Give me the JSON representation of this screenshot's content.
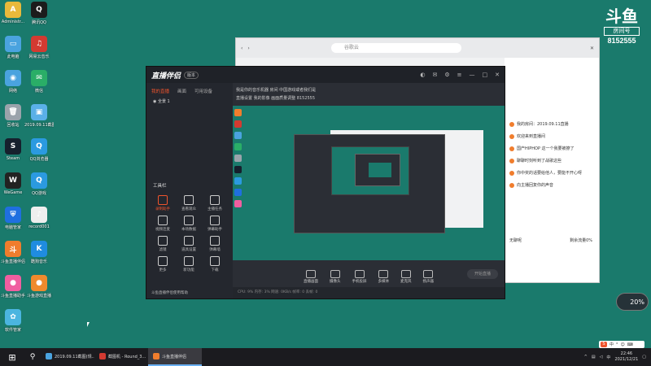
{
  "desktop_icons": [
    {
      "label": "Administr...",
      "color": "#e8b93b",
      "glyph": "A"
    },
    {
      "label": "腾讯QQ",
      "color": "#1c1c1c",
      "glyph": "Q"
    },
    {
      "label": "此电脑",
      "color": "#4aa3df",
      "glyph": "▭"
    },
    {
      "label": "网易云音乐",
      "color": "#d33a31",
      "glyph": "♫"
    },
    {
      "label": "网络",
      "color": "#4aa3df",
      "glyph": "◉"
    },
    {
      "label": "微信",
      "color": "#2aae67",
      "glyph": "✉"
    },
    {
      "label": "回收站",
      "color": "#9aa3ab",
      "glyph": "🗑"
    },
    {
      "label": "2019.09.11截图",
      "color": "#5ab0e8",
      "glyph": "▣"
    },
    {
      "label": "Steam",
      "color": "#16202d",
      "glyph": "S"
    },
    {
      "label": "QQ浏览器",
      "color": "#2b9ae0",
      "glyph": "Q"
    },
    {
      "label": "WeGame",
      "color": "#222",
      "glyph": "W"
    },
    {
      "label": "QQ游戏",
      "color": "#2b9ae0",
      "glyph": "Q"
    },
    {
      "label": "电脑管家",
      "color": "#1f6fe0",
      "glyph": "⛨"
    },
    {
      "label": "record001",
      "color": "#eee",
      "glyph": "♪"
    },
    {
      "label": "斗鱼直播伴侣",
      "color": "#f07d2d",
      "glyph": "斗"
    },
    {
      "label": "酷狗音乐",
      "color": "#1f8ce0",
      "glyph": "K"
    },
    {
      "label": "斗鱼直播助手",
      "color": "#f05ea0",
      "glyph": "●"
    },
    {
      "label": "斗鱼游戏直播",
      "color": "#f08a2d",
      "glyph": "●"
    },
    {
      "label": "软件管家",
      "color": "#4bb5e0",
      "glyph": "✿"
    }
  ],
  "douyu": {
    "logo": "斗鱼",
    "room_label": "房间号",
    "room_number": "8152555"
  },
  "browser": {
    "address": "谷歌云",
    "chat": [
      "我的房间：2019.09.11直播",
      "欢迎来到直播间",
      "国产HIPHOP 这一个我要被撩了",
      "聊聊时刻听到了战歌这些",
      "你中奖的话要给他人，要能不开心呀",
      "向主播回复你的声音"
    ],
    "bottom_left": "无聊呢",
    "bottom_right": "剩余流量0%"
  },
  "app": {
    "title": "直播伴侣",
    "version": "版本",
    "tabs": [
      "我的直播",
      "画面",
      "可用设备"
    ],
    "scene": "全景 1",
    "tools_title": "工具栏",
    "tools": [
      {
        "label": "录制助手",
        "red": true
      },
      {
        "label": "查看观众",
        "red": false
      },
      {
        "label": "主播任务",
        "red": false
      },
      {
        "label": "视频连麦",
        "red": false
      },
      {
        "label": "本场数据",
        "red": false
      },
      {
        "label": "弹幕助手",
        "red": false
      },
      {
        "label": "滤镜",
        "red": false
      },
      {
        "label": "道具设置",
        "red": false
      },
      {
        "label": "弹幕墙",
        "red": false
      },
      {
        "label": "更多",
        "red": false
      },
      {
        "label": "新功能",
        "red": false
      },
      {
        "label": "下载",
        "red": false
      }
    ],
    "footer": "斗鱼直播伴侣使用帮助",
    "room_line1": "我是你的音乐机器  房间  中国游戏或者我们是",
    "room_line2": "直播设置  我的影像  画面质量调整  8152555",
    "controls": [
      "直播画面",
      "摄像头",
      "手机投屏",
      "多媒体",
      "麦克风",
      "扬声器"
    ],
    "start_btn": "开始直播",
    "status": "CPU: 9%  内存: 3%  网速: 0KB/s  帧率: 0  丢帧: 0"
  },
  "taskbar": {
    "items": [
      {
        "label": "2019.09.11截图(规...",
        "color": "#4aa3df",
        "active": false
      },
      {
        "label": "截图机 - Round_3...",
        "color": "#d33a31",
        "active": false
      },
      {
        "label": "斗鱼直播伴侣",
        "color": "#f07d2d",
        "active": true
      }
    ],
    "ime": "中",
    "time": "22:46",
    "date": "2021/12/21"
  },
  "float_badge": "20%"
}
